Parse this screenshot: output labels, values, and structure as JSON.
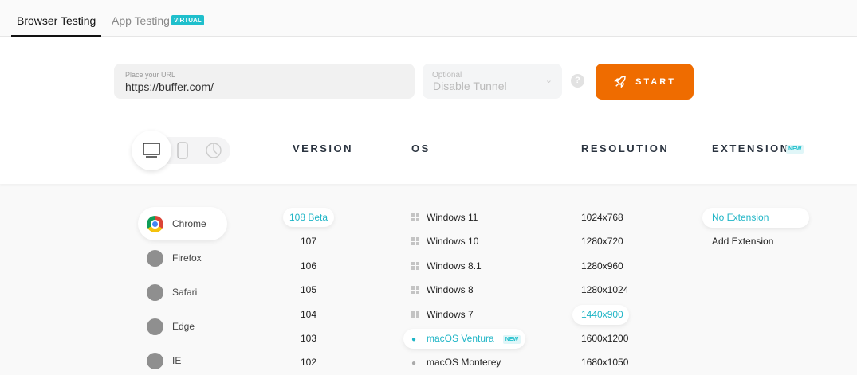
{
  "tabs": {
    "browser": "Browser Testing",
    "app": "App Testing",
    "app_badge": "VIRTUAL"
  },
  "url": {
    "label": "Place your URL",
    "value": "https://buffer.com/"
  },
  "tunnel": {
    "label": "Optional",
    "value": "Disable Tunnel"
  },
  "help": "?",
  "start": "START",
  "headers": {
    "version": "VERSION",
    "os": "OS",
    "resolution": "RESOLUTION",
    "extension": "EXTENSION",
    "extension_badge": "NEW"
  },
  "browsers": [
    {
      "label": "Chrome",
      "selected": true
    },
    {
      "label": "Firefox"
    },
    {
      "label": "Safari"
    },
    {
      "label": "Edge"
    },
    {
      "label": "IE"
    }
  ],
  "versions": [
    {
      "label": "108 Beta",
      "selected": true
    },
    {
      "label": "107"
    },
    {
      "label": "106"
    },
    {
      "label": "105"
    },
    {
      "label": "104"
    },
    {
      "label": "103"
    },
    {
      "label": "102"
    }
  ],
  "os": [
    {
      "label": "Windows 11",
      "icon": "windows"
    },
    {
      "label": "Windows 10",
      "icon": "windows"
    },
    {
      "label": "Windows 8.1",
      "icon": "windows"
    },
    {
      "label": "Windows 8",
      "icon": "windows"
    },
    {
      "label": "Windows 7",
      "icon": "windows"
    },
    {
      "label": "macOS Ventura",
      "icon": "apple",
      "selected": true,
      "badge": "NEW"
    },
    {
      "label": "macOS Monterey",
      "icon": "apple"
    }
  ],
  "resolutions": [
    {
      "label": "1024x768"
    },
    {
      "label": "1280x720"
    },
    {
      "label": "1280x960"
    },
    {
      "label": "1280x1024"
    },
    {
      "label": "1440x900",
      "selected": true
    },
    {
      "label": "1600x1200"
    },
    {
      "label": "1680x1050"
    }
  ],
  "extensions": [
    {
      "label": "No Extension",
      "selected": true
    },
    {
      "label": "Add Extension"
    }
  ],
  "colors": {
    "accent": "#1fbfcc",
    "start": "#ef6c00"
  }
}
